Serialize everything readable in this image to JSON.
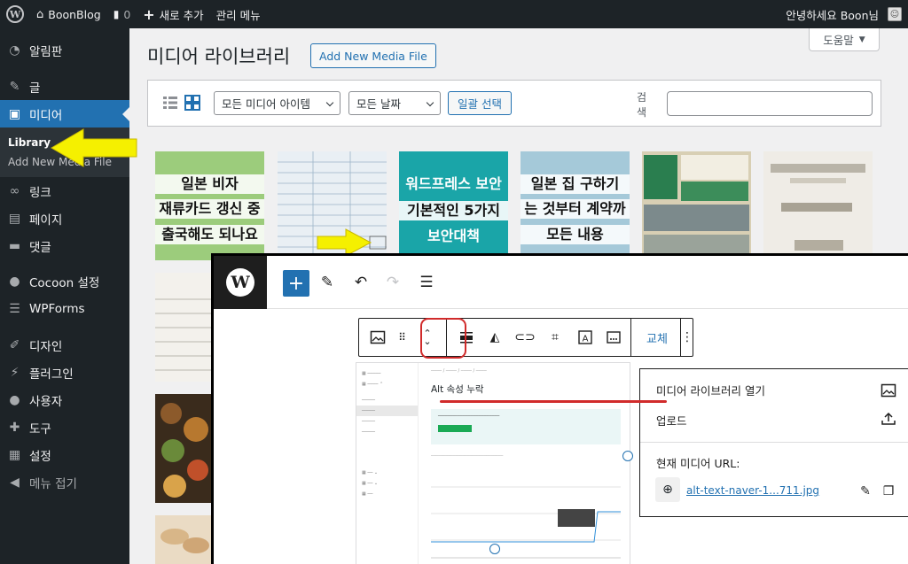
{
  "adminbar": {
    "site_name": "BoonBlog",
    "comments_count": "0",
    "new_label": "새로 추가",
    "manage_menu": "관리 메뉴",
    "greeting": "안녕하세요 Boon님"
  },
  "sidebar": {
    "items": [
      {
        "label": "알림판",
        "icon": "dashboard-icon"
      },
      {
        "label": "글",
        "icon": "pin-icon"
      },
      {
        "label": "미디어",
        "icon": "media-icon"
      },
      {
        "label": "링크",
        "icon": "link-icon"
      },
      {
        "label": "페이지",
        "icon": "page-icon"
      },
      {
        "label": "댓글",
        "icon": "comment-icon"
      },
      {
        "label": "Cocoon 설정",
        "icon": "cocoon-icon"
      },
      {
        "label": "WPForms",
        "icon": "forms-icon"
      },
      {
        "label": "디자인",
        "icon": "brush-icon"
      },
      {
        "label": "플러그인",
        "icon": "plugin-icon"
      },
      {
        "label": "사용자",
        "icon": "user-icon"
      },
      {
        "label": "도구",
        "icon": "wrench-icon"
      },
      {
        "label": "설정",
        "icon": "settings-icon"
      },
      {
        "label": "메뉴 접기",
        "icon": "collapse-icon"
      }
    ],
    "submenu": {
      "library": "Library",
      "add_new": "Add New Media File"
    }
  },
  "main": {
    "help": "도움말",
    "title": "미디어 라이브러리",
    "add_new": "Add New Media File",
    "filter_type": "모든 미디어 아이템",
    "filter_date": "모든 날짜",
    "bulk_select": "일괄 선택",
    "search_label": "검색"
  },
  "thumbnails": [
    {
      "lines": [
        "일본 비자",
        "재류카드 갱신 중",
        "출국해도 되나요"
      ],
      "bg": "#9ccc7c"
    },
    {
      "lines": [],
      "bg": "#dfe8ef"
    },
    {
      "lines": [
        "워드프레스 보안",
        "기본적인 5가지",
        "보안대책"
      ],
      "bg": "#1aa5a8"
    },
    {
      "lines": [
        "일본 집 구하기",
        "는 것부터 계약까",
        "모든 내용"
      ],
      "bg": "#a5c9d9"
    },
    {
      "lines": [],
      "bg": "#cfc3a0"
    },
    {
      "lines": [],
      "bg": "#e6e4df"
    }
  ],
  "editor": {
    "replace": "교체",
    "preview_title": "Alt 속성 누락",
    "dropdown": {
      "open_library": "미디어 라이브러리 열기",
      "upload": "업로드",
      "current_url_label": "현재 미디어 URL:",
      "current_url": "alt-text-naver-1...711.jpg"
    }
  },
  "colors": {
    "admin_dark": "#1d2327",
    "accent": "#2271b1",
    "annotation_red": "#d12b2b",
    "annotation_yellow": "#f5f000"
  }
}
